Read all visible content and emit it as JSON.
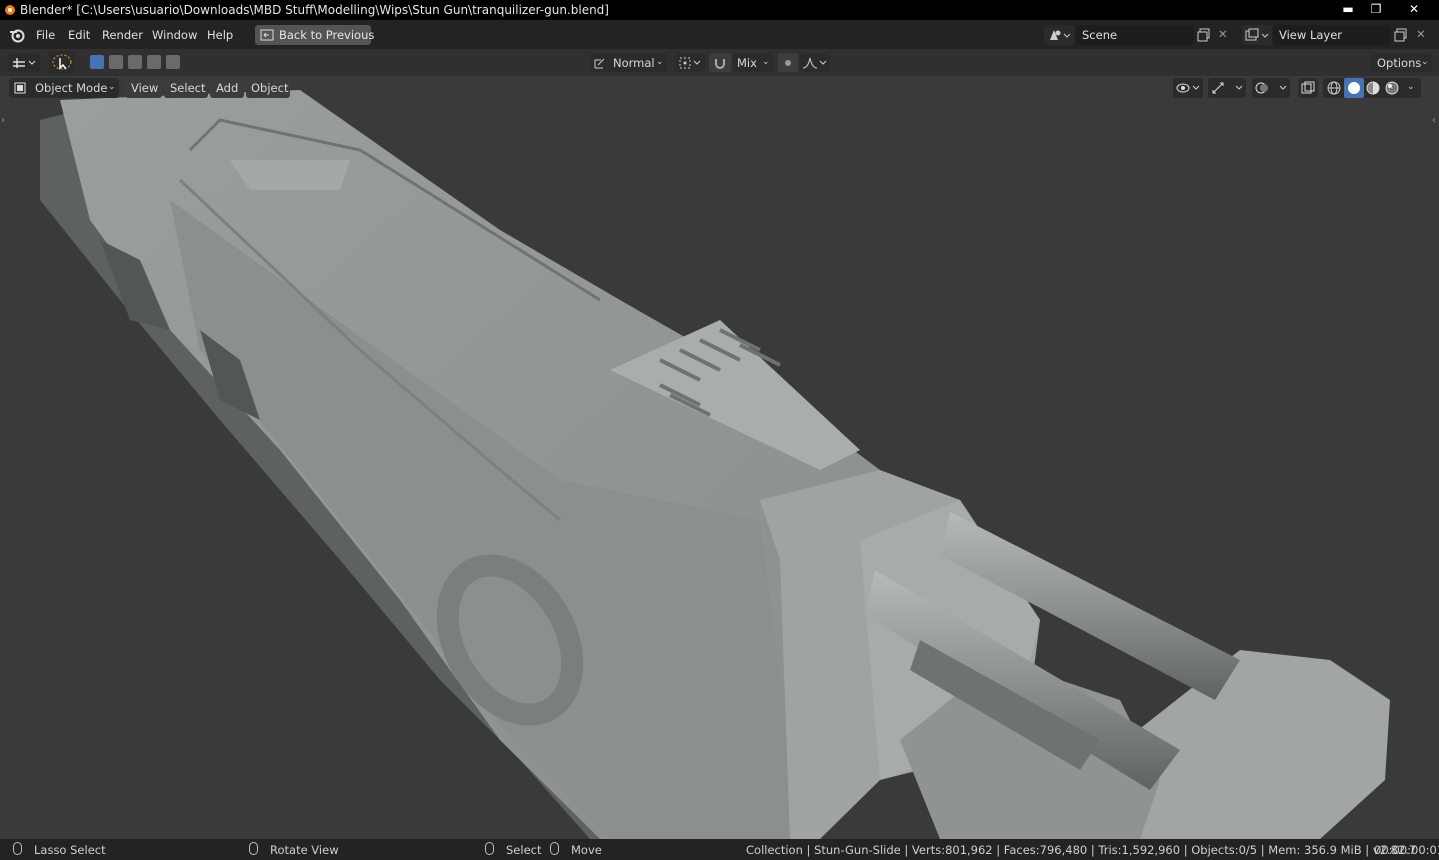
{
  "window": {
    "title": "Blender* [C:\\Users\\usuario\\Downloads\\MBD Stuff\\Modelling\\Wips\\Stun Gun\\tranquilizer-gun.blend]",
    "controls": {
      "minimize": "▬",
      "maximize": "❐",
      "close": "✕"
    }
  },
  "menubar": {
    "items": [
      "File",
      "Edit",
      "Render",
      "Window",
      "Help"
    ],
    "back_button": "Back to Previous",
    "scene": "Scene",
    "view_layer": "View Layer"
  },
  "tool_header": {
    "orientation": "Normal",
    "snap_mode": "Mix",
    "options": "Options"
  },
  "viewport_header": {
    "mode": "Object Mode",
    "menus": [
      "View",
      "Select",
      "Add",
      "Object"
    ]
  },
  "statusbar": {
    "left_action": "Lasso Select",
    "middle_action": "Rotate View",
    "select_action": "Select",
    "move_action": "Move",
    "stats": "Collection | Stun-Gun-Slide | Verts:801,962 | Faces:796,480 | Tris:1,592,960 | Objects:0/5 | Mem: 356.9 MiB | v2.82.7",
    "timer": "00:00:00:01"
  },
  "colors": {
    "accent": "#4772b3",
    "background": "#3a3a3a",
    "header": "#232323",
    "model": "#8f9392"
  }
}
